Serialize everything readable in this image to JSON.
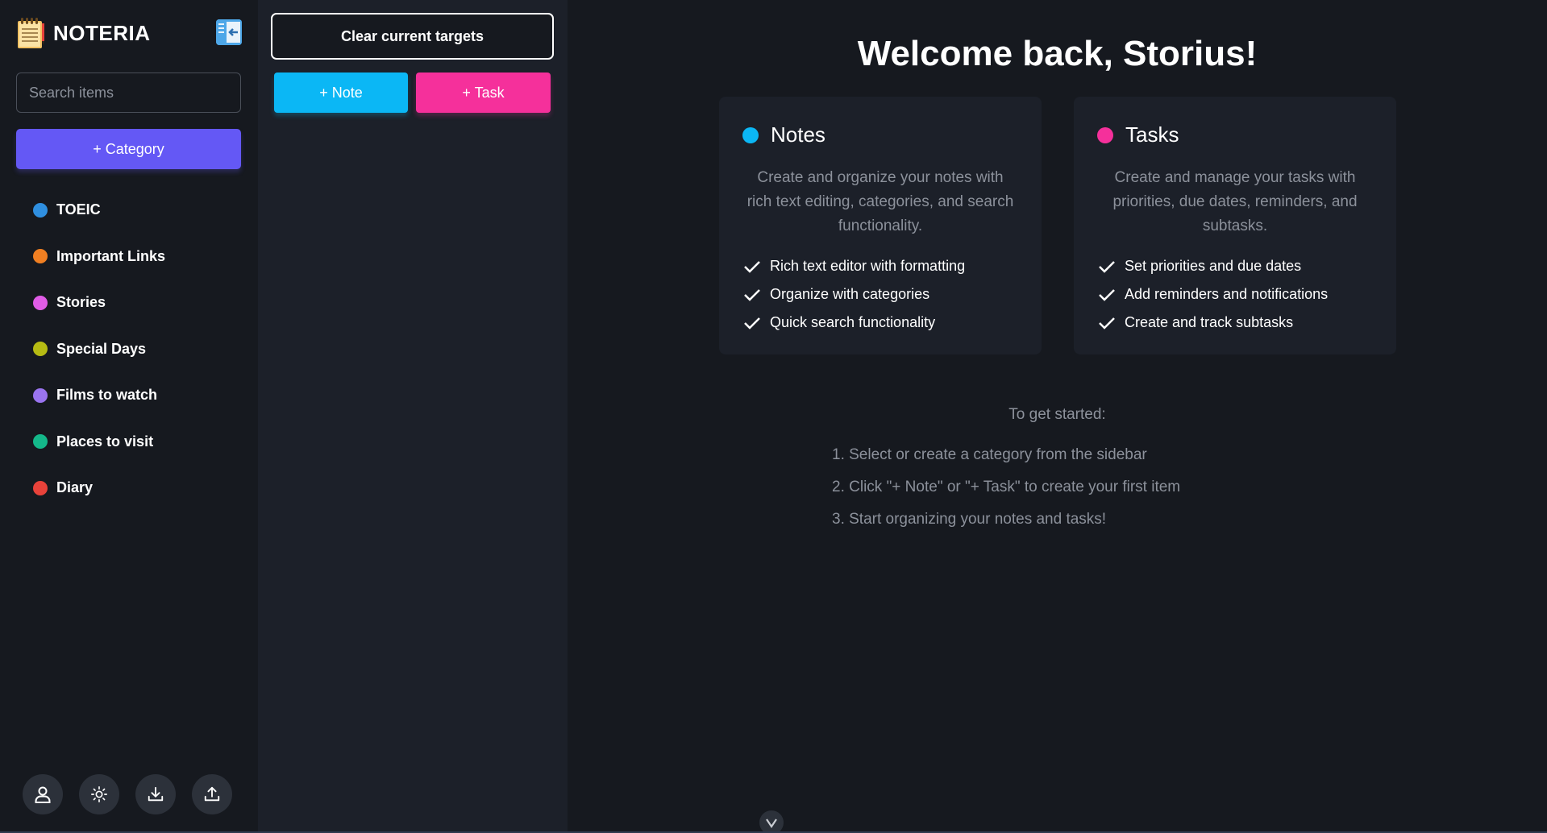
{
  "sidebar": {
    "brand": "NOTERIA",
    "search_placeholder": "Search items",
    "add_category_label": "+ Category",
    "categories": [
      {
        "label": "TOEIC",
        "color": "#2f8fe0"
      },
      {
        "label": "Important Links",
        "color": "#f07f22"
      },
      {
        "label": "Stories",
        "color": "#e05ce6"
      },
      {
        "label": "Special Days",
        "color": "#b6bb13"
      },
      {
        "label": "Films to watch",
        "color": "#9a74f0"
      },
      {
        "label": "Places to visit",
        "color": "#14b88a"
      },
      {
        "label": "Diary",
        "color": "#e8423a"
      }
    ],
    "bottom_icons": [
      "user-icon",
      "sun-icon",
      "download-icon",
      "upload-icon"
    ]
  },
  "list_panel": {
    "clear_label": "Clear current targets",
    "add_note_label": "+ Note",
    "add_task_label": "+ Task"
  },
  "main": {
    "welcome": "Welcome back, Storius!",
    "cards": [
      {
        "title": "Notes",
        "color": "#0bb7f5",
        "description": "Create and organize your notes with rich text editing, categories, and search functionality.",
        "features": [
          "Rich text editor with formatting",
          "Organize with categories",
          "Quick search functionality"
        ]
      },
      {
        "title": "Tasks",
        "color": "#f5309b",
        "description": "Create and manage your tasks with priorities, due dates, reminders, and subtasks.",
        "features": [
          "Set priorities and due dates",
          "Add reminders and notifications",
          "Create and track subtasks"
        ]
      }
    ],
    "started_title": "To get started:",
    "steps": [
      "1. Select or create a category from the sidebar",
      "2. Click \"+ Note\" or \"+ Task\" to create your first item",
      "3. Start organizing your notes and tasks!"
    ]
  },
  "colors": {
    "bg": "#16191f",
    "panel": "#1c2029",
    "accent_purple": "#6458f5",
    "note_blue": "#0bb7f5",
    "task_pink": "#f5309b",
    "muted_text": "#8c919b"
  }
}
